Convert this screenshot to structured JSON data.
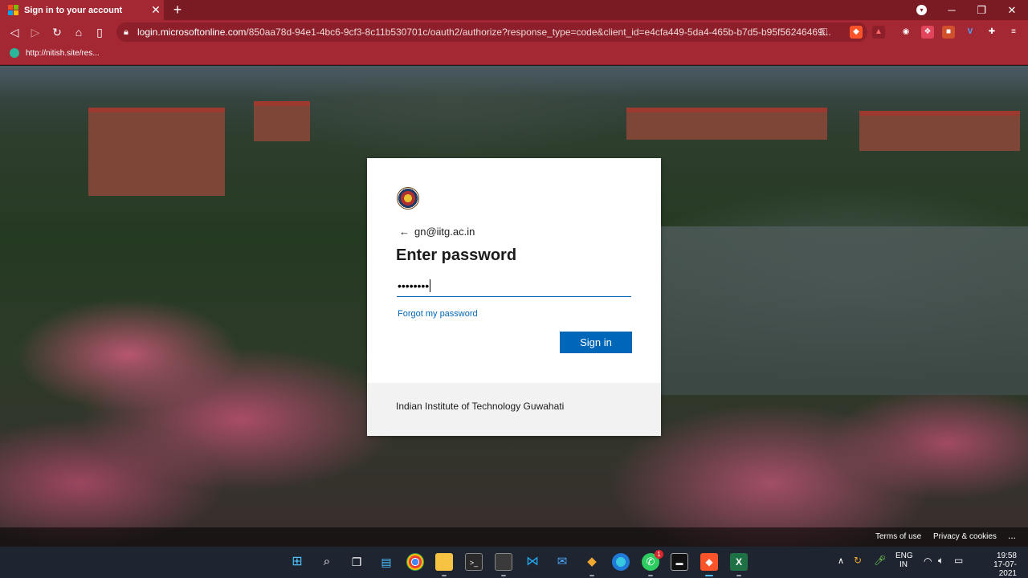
{
  "browser": {
    "tab_title": "Sign in to your account",
    "new_tab": "+",
    "url_host": "login.microsoftonline.com",
    "url_path": "/850aa78d-94e1-4bc6-9cf3-8c11b530701c/oauth2/authorize?response_type=code&client_id=e4cfa449-5da4-465b-b7d5-b95f56246469...",
    "bookmark": "http://nitish.site/res..."
  },
  "signin": {
    "account": "gn@iitg.ac.in",
    "heading": "Enter password",
    "password_mask": "••••••••",
    "forgot": "Forgot my password",
    "button": "Sign in",
    "organization": "Indian Institute of Technology Guwahati"
  },
  "page_footer": {
    "terms": "Terms of use",
    "privacy": "Privacy & cookies",
    "more": "..."
  },
  "taskbar": {
    "lang_top": "ENG",
    "lang_bottom": "IN",
    "time": "19:58",
    "date": "17-07-2021",
    "whatsapp_badge": "1"
  },
  "colors": {
    "chrome_dark": "#7a1a22",
    "chrome": "#a42834",
    "accent": "#0067b8"
  }
}
